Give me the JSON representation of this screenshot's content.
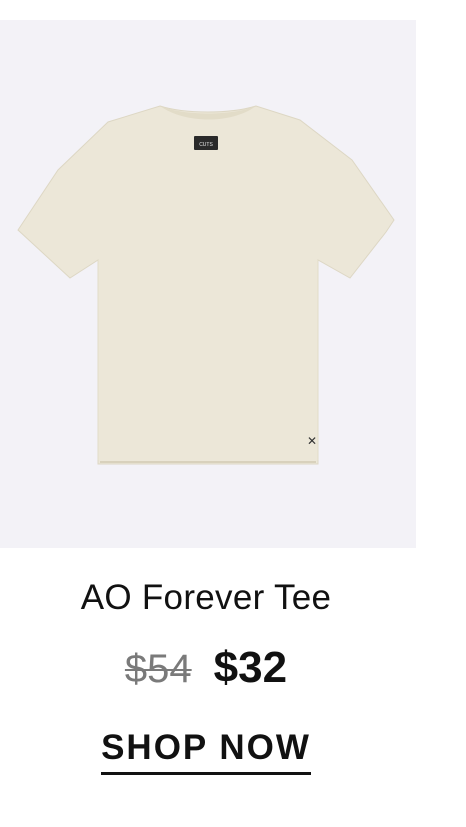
{
  "product": {
    "image_alt": "Cream short-sleeve t-shirt",
    "label_text": "CUTS",
    "title": "AO Forever Tee",
    "price_original": "$54",
    "price_sale": "$32",
    "cta_label": "SHOP NOW"
  },
  "colors": {
    "background": "#f3f2f7",
    "shirt": "#ece7d8",
    "text": "#111111",
    "strike": "#7a7a7a"
  },
  "icons": {
    "hem_logo": "x-mark-icon"
  }
}
